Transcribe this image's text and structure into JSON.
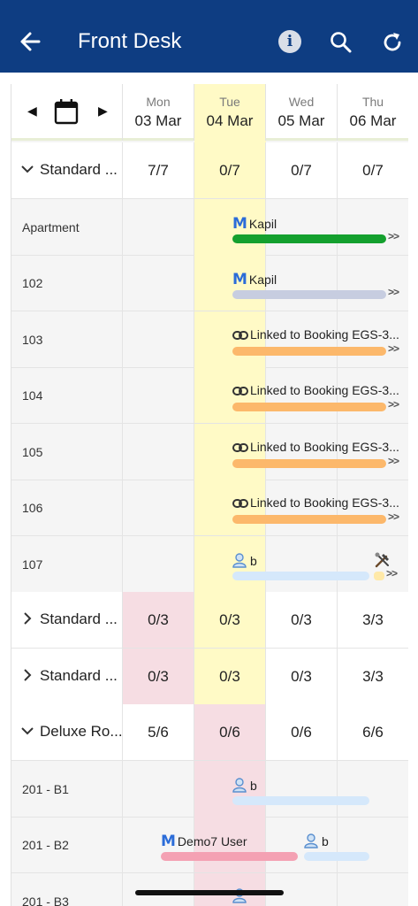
{
  "header": {
    "title": "Front Desk",
    "colors": {
      "bar": "#0e3d82",
      "today": "#fffac6",
      "full": "#f6dde3"
    }
  },
  "calendar": {
    "days": [
      {
        "dow": "Mon",
        "date": "03 Mar"
      },
      {
        "dow": "Tue",
        "date": "04 Mar"
      },
      {
        "dow": "Wed",
        "date": "05 Mar"
      },
      {
        "dow": "Thu",
        "date": "06 Mar"
      }
    ]
  },
  "categories": [
    {
      "name": "Standard ...",
      "counts": [
        "7/7",
        "0/7",
        "0/7",
        "0/7"
      ]
    },
    {
      "name": "Standard ...",
      "counts": [
        "0/3",
        "0/3",
        "0/3",
        "3/3"
      ]
    },
    {
      "name": "Standard ...",
      "counts": [
        "0/3",
        "0/3",
        "0/3",
        "3/3"
      ]
    },
    {
      "name": "Deluxe Ro...",
      "counts": [
        "5/6",
        "0/6",
        "0/6",
        "6/6"
      ]
    }
  ],
  "rooms": [
    {
      "name": "Apartment",
      "booking": "Kapil",
      "bar_color": "#14a02e"
    },
    {
      "name": "102",
      "booking": "Kapil",
      "bar_color": "#c7cde0"
    },
    {
      "name": "103",
      "booking": "Linked to Booking EGS-3...",
      "bar_color": "#fcb86b"
    },
    {
      "name": "104",
      "booking": "Linked to Booking EGS-3...",
      "bar_color": "#fcb86b"
    },
    {
      "name": "105",
      "booking": "Linked to Booking EGS-3...",
      "bar_color": "#fcb86b"
    },
    {
      "name": "106",
      "booking": "Linked to Booking EGS-3...",
      "bar_color": "#fcb86b"
    },
    {
      "name": "107",
      "booking": "b",
      "bar_color": "#d5e8fb"
    },
    {
      "name": "201 - B1",
      "booking": "b",
      "bar_color": "#d5e8fb"
    },
    {
      "name": "201 - B2",
      "booking": "Demo7 User",
      "booking2": "b",
      "bar_color": "#f4a1b3"
    },
    {
      "name": "201 - B3"
    }
  ],
  "more_marker": ">>"
}
